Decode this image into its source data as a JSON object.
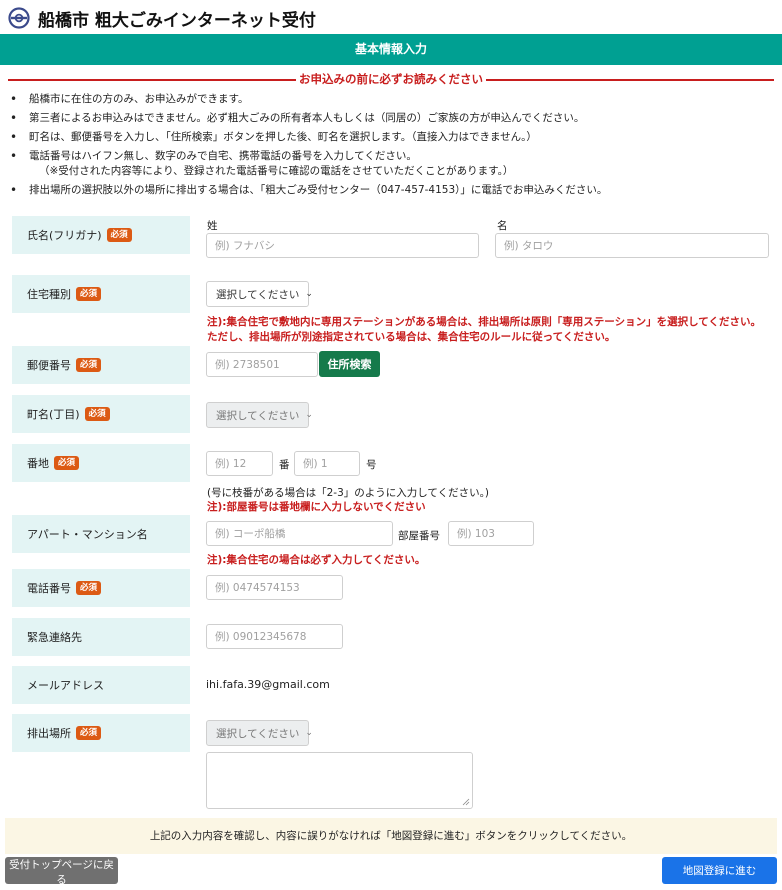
{
  "header": {
    "title": "船橋市 粗大ごみインターネット受付",
    "logo_icon": "funabashi-city-emblem"
  },
  "banner": {
    "title": "基本情報入力"
  },
  "notice": {
    "title": "お申込みの前に必ずお読みください",
    "items": [
      "船橋市に在住の方のみ、お申込みができます。",
      "第三者によるお申込みはできません。必ず粗大ごみの所有者本人もしくは（同居の）ご家族の方が申込んでください。",
      "町名は、郵便番号を入力し、「住所検索」ボタンを押した後、町名を選択します。（直接入力はできません。）",
      "電話番号はハイフン無し、数字のみで自宅、携帯電話の番号を入力してください。",
      "排出場所の選択肢以外の場所に排出する場合は、「粗大ごみ受付センター（047-457-4153）」に電話でお申込みください。"
    ],
    "phone_subnote": "（※受付された内容等により、登録された電話番号に確認の電話をさせていただくことがあります。）"
  },
  "required_badge": "必須",
  "form": {
    "name": {
      "label": "氏名(フリガナ)",
      "sei_label": "姓",
      "mei_label": "名",
      "sei_placeholder": "例) フナバシ",
      "mei_placeholder": "例) タロウ"
    },
    "housing": {
      "label": "住宅種別",
      "select_value": "選択してください",
      "note_line1": "注):集合住宅で敷地内に専用ステーションがある場合は、排出場所は原則「専用ステーション」を選択してください。",
      "note_line2": "ただし、排出場所が別途指定されている場合は、集合住宅のルールに従ってください。"
    },
    "postal": {
      "label": "郵便番号",
      "placeholder": "例) 2738501",
      "search_button": "住所検索"
    },
    "town": {
      "label": "町名(丁目)",
      "select_value": "選択してください"
    },
    "banchi": {
      "label": "番地",
      "placeholder_1": "例) 12",
      "unit_1": "番",
      "placeholder_2": "例) 1",
      "unit_2": "号",
      "note": "(号に枝番がある場合は「2-3」のように入力してください。)",
      "red_note": "注):部屋番号は番地欄に入力しないでください"
    },
    "apartment": {
      "label": "アパート・マンション名",
      "placeholder": "例) コーポ船橋",
      "room_label": "部屋番号",
      "room_placeholder": "例) 103",
      "red_note": "注):集合住宅の場合は必ず入力してください。"
    },
    "phone": {
      "label": "電話番号",
      "placeholder": "例) 0474574153"
    },
    "emergency": {
      "label": "緊急連絡先",
      "placeholder": "例) 09012345678"
    },
    "email": {
      "label": "メールアドレス",
      "value": "ihi.fafa.39@gmail.com"
    },
    "location": {
      "label": "排出場所",
      "select_value": "選択してください"
    }
  },
  "confirm": {
    "text": "上記の入力内容を確認し、内容に誤りがなければ「地図登録に進む」ボタンをクリックしてください。"
  },
  "buttons": {
    "back": "受付トップページに戻る",
    "next": "地図登録に進む"
  },
  "colors": {
    "banner": "#00a092",
    "label_bg": "#e3f4f4",
    "required_badge": "#dc5a14",
    "notice_red": "#c81e1e",
    "search_button": "#157a4b",
    "next_button": "#1a73e8",
    "back_button": "#707070",
    "confirm_bg": "#fbf6e4"
  }
}
